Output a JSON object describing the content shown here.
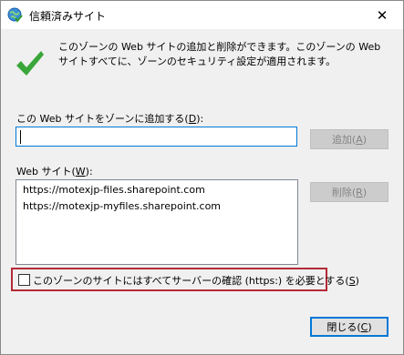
{
  "window": {
    "title": "信頼済みサイト",
    "close_symbol": "✕"
  },
  "info": {
    "text": "このゾーンの Web サイトの追加と削除ができます。このゾーンの Web サイトすべてに、ゾーンのセキュリティ設定が適用されます。",
    "icon": "checkmark-icon",
    "icon_color": "#3aa63a"
  },
  "add_section": {
    "label": "この Web サイトをゾーンに追加する(",
    "label_key": "D",
    "label_end": "):",
    "input_value": "",
    "add_button_label": "追加(",
    "add_button_key": "A",
    "add_button_end": ")"
  },
  "sites_section": {
    "label": "Web サイト(",
    "label_key": "W",
    "label_end": "):",
    "sites": [
      "https://motexjp-files.sharepoint.com",
      "https://motexjp-myfiles.sharepoint.com"
    ],
    "remove_button_label": "削除(",
    "remove_button_key": "R",
    "remove_button_end": ")"
  },
  "https_option": {
    "label": "このゾーンのサイトにはすべてサーバーの確認 (https:) を必要とする(",
    "label_key": "S",
    "label_end": ")",
    "checked": false,
    "highlight_color": "#b22a36"
  },
  "footer": {
    "close_button_label": "閉じる(",
    "close_button_key": "C",
    "close_button_end": ")"
  }
}
